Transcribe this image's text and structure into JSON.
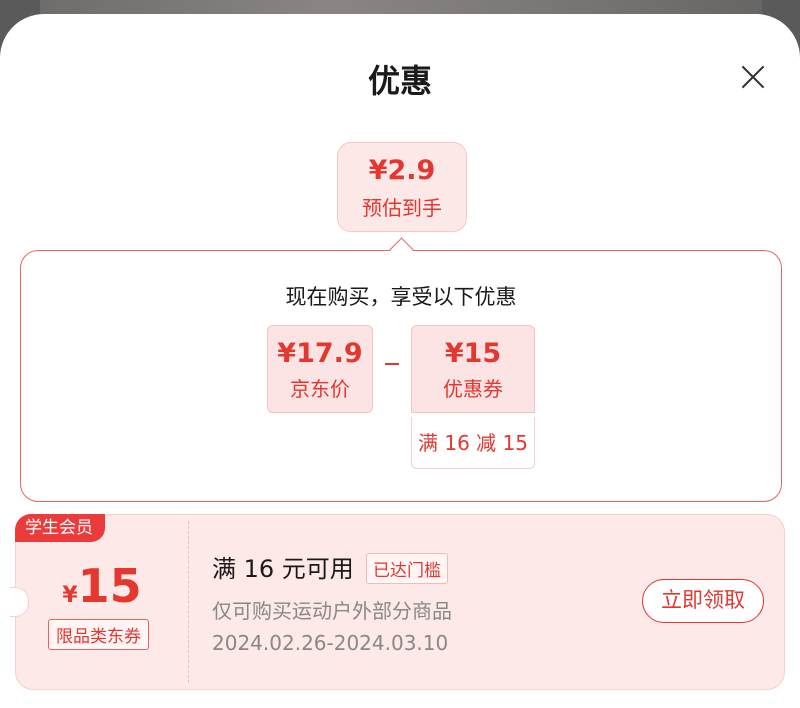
{
  "sheet": {
    "title": "优惠"
  },
  "estimate": {
    "price": "¥2.9",
    "label": "预估到手"
  },
  "detail": {
    "heading": "现在购买，享受以下优惠",
    "jd_price": {
      "amount": "¥17.9",
      "label": "京东价"
    },
    "operator": "−",
    "coupon_discount": {
      "amount": "¥15",
      "label": "优惠券",
      "condition": "满 16 减 15"
    }
  },
  "coupon": {
    "tag": "学生会员",
    "currency": "¥",
    "amount": "15",
    "type": "限品类东券",
    "condition": "满 16 元可用",
    "status": "已达门槛",
    "scope": "仅可购买运动户外部分商品",
    "period": "2024.02.26-2024.03.10",
    "claim_label": "立即领取"
  },
  "colors": {
    "accent": "#e3372f",
    "tile_bg": "#fde4e4",
    "tag_bg": "#ec3b3b"
  }
}
